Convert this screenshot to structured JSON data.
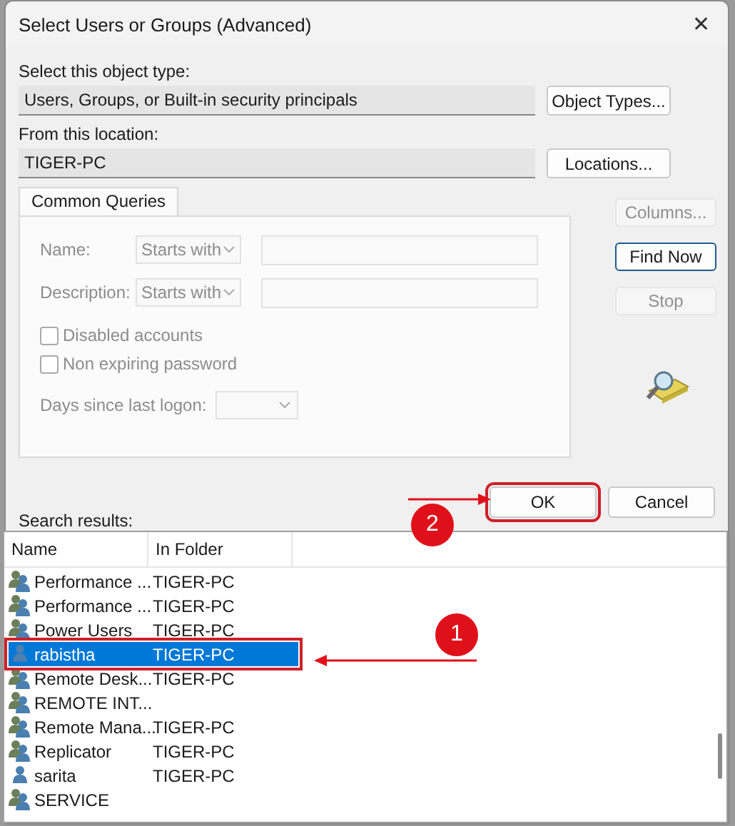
{
  "window": {
    "title": "Select Users or Groups (Advanced)",
    "close": "✕"
  },
  "object_type": {
    "label": "Select this object type:",
    "value": "Users, Groups, or Built-in security principals",
    "button": "Object Types..."
  },
  "location": {
    "label": "From this location:",
    "value": "TIGER-PC",
    "button": "Locations..."
  },
  "query_tabs": [
    {
      "label": "Common Queries",
      "selected": true
    }
  ],
  "query": {
    "disabled": true,
    "fields": [
      {
        "label": "Name:",
        "mode": "Starts with"
      },
      {
        "label": "Description:",
        "mode": "Starts with"
      }
    ],
    "checkboxes": [
      {
        "label": "Disabled accounts",
        "checked": false
      },
      {
        "label": "Non expiring password",
        "checked": false
      }
    ],
    "days_label": "Days since last logon:"
  },
  "side_buttons": [
    {
      "label": "Columns...",
      "disabled": true,
      "default": false
    },
    {
      "label": "Find Now",
      "disabled": false,
      "default": true
    },
    {
      "label": "Stop",
      "disabled": true,
      "default": false
    }
  ],
  "dialog_buttons": [
    {
      "label": "OK",
      "highlighted": true
    },
    {
      "label": "Cancel",
      "highlighted": false
    }
  ],
  "results": {
    "label": "Search results:",
    "columns": [
      "Name",
      "In Folder"
    ],
    "rows": [
      {
        "kind": "group",
        "name": "Performance ...",
        "folder": "TIGER-PC",
        "selected": false,
        "highlighted": false
      },
      {
        "kind": "group",
        "name": "Performance ...",
        "folder": "TIGER-PC",
        "selected": false,
        "highlighted": false
      },
      {
        "kind": "group",
        "name": "Power Users",
        "folder": "TIGER-PC",
        "selected": false,
        "highlighted": false
      },
      {
        "kind": "user",
        "name": "rabistha",
        "folder": "TIGER-PC",
        "selected": true,
        "highlighted": true
      },
      {
        "kind": "group",
        "name": "Remote Desk...",
        "folder": "TIGER-PC",
        "selected": false,
        "highlighted": false
      },
      {
        "kind": "group",
        "name": "REMOTE INT...",
        "selected": false,
        "highlighted": false
      },
      {
        "kind": "group",
        "name": "Remote Mana...",
        "folder": "TIGER-PC",
        "selected": false,
        "highlighted": false
      },
      {
        "kind": "group",
        "name": "Replicator",
        "folder": "TIGER-PC",
        "selected": false,
        "highlighted": false
      },
      {
        "kind": "user",
        "name": "sarita",
        "folder": "TIGER-PC",
        "selected": false,
        "highlighted": false
      },
      {
        "kind": "group",
        "name": "SERVICE",
        "selected": false,
        "highlighted": false
      }
    ]
  },
  "callouts": [
    {
      "number": "2"
    },
    {
      "number": "1"
    }
  ]
}
